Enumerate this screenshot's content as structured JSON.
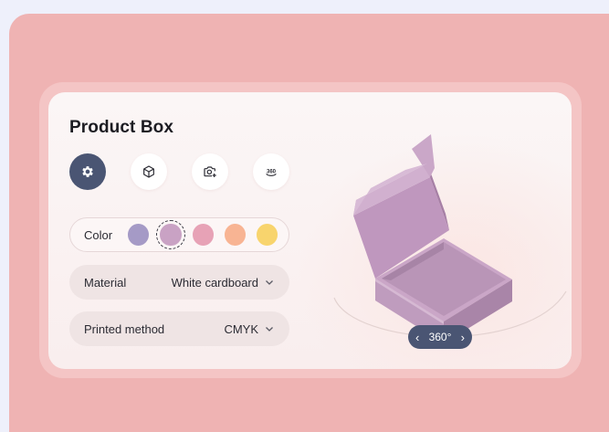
{
  "product": {
    "title": "Product Box"
  },
  "toolbar": {
    "tools": [
      {
        "icon": "gear-icon",
        "active": true
      },
      {
        "icon": "cube-icon",
        "active": false
      },
      {
        "icon": "camera-add-icon",
        "active": false
      },
      {
        "icon": "rotate-360-icon",
        "label": "360",
        "active": false
      }
    ]
  },
  "options": {
    "color": {
      "label": "Color",
      "swatches": [
        "#a59ac6",
        "#c9a2c4",
        "#e7a2b6",
        "#f8b493",
        "#f8d46d"
      ],
      "selected_index": 1
    },
    "material": {
      "label": "Material",
      "value": "White cardboard"
    },
    "printed": {
      "label": "Printed method",
      "value": "CMYK"
    }
  },
  "viewer": {
    "box_color": "#c9a2c4",
    "rotate_label": "360°",
    "prev_icon": "chevron-left-icon",
    "next_icon": "chevron-right-icon"
  },
  "colors": {
    "background": "#efb3b3",
    "card": "#fbf6f6",
    "accent": "#4a5573"
  }
}
